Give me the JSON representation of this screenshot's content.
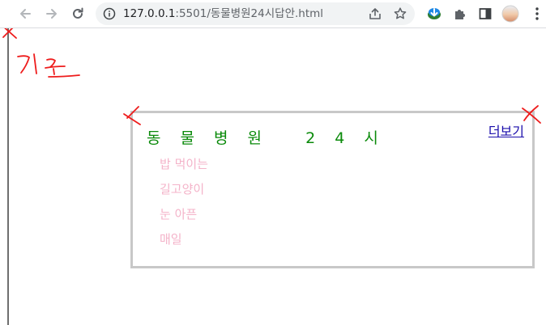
{
  "browser": {
    "url_host": "127.0.0.1",
    "url_rest": ":5501/동물병원24시답안.html",
    "back_icon": "arrow-left-icon",
    "forward_icon": "arrow-right-icon",
    "reload_icon": "reload-icon",
    "info_icon": "info-icon",
    "share_icon": "share-icon",
    "bookmark_icon": "star-icon"
  },
  "extensions": [
    "download-manager-icon",
    "puzzle-icon",
    "side-panel-icon",
    "profile-avatar"
  ],
  "annotation": {
    "label": "기준",
    "color": "#ee1c1c"
  },
  "box": {
    "title": "동 물 병 원   2 4 시",
    "more_link": "더보기",
    "items": [
      "밥 먹이는",
      "길고양이",
      "눈 아픈",
      "매일"
    ]
  },
  "colors": {
    "title": "#0a8a0a",
    "items": "#f4b3c9",
    "link": "#1a0dab",
    "border": "#c8c8c8"
  }
}
